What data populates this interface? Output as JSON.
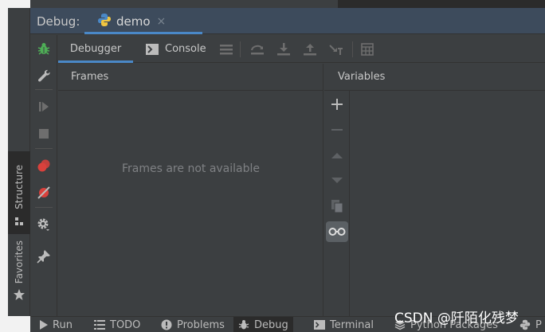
{
  "debug": {
    "label": "Debug:",
    "tab_name": "demo",
    "close": "×"
  },
  "side_tabs": {
    "structure": "Structure",
    "favorites": "Favorites"
  },
  "tabs": {
    "debugger": "Debugger",
    "console": "Console"
  },
  "frames": {
    "header": "Frames",
    "empty": "Frames are not available"
  },
  "variables": {
    "header": "Variables"
  },
  "bottom": {
    "run": "Run",
    "todo": "TODO",
    "problems": "Problems",
    "debug": "Debug",
    "terminal": "Terminal",
    "python_packages": "Python Packages",
    "cut": "P"
  },
  "watermark": "CSDN @阡陌化残梦",
  "colors": {
    "accent": "#4a88c7",
    "bug_green": "#4eae56",
    "breakpoint_red": "#d9413c",
    "header_blue": "#3d4b5c"
  }
}
